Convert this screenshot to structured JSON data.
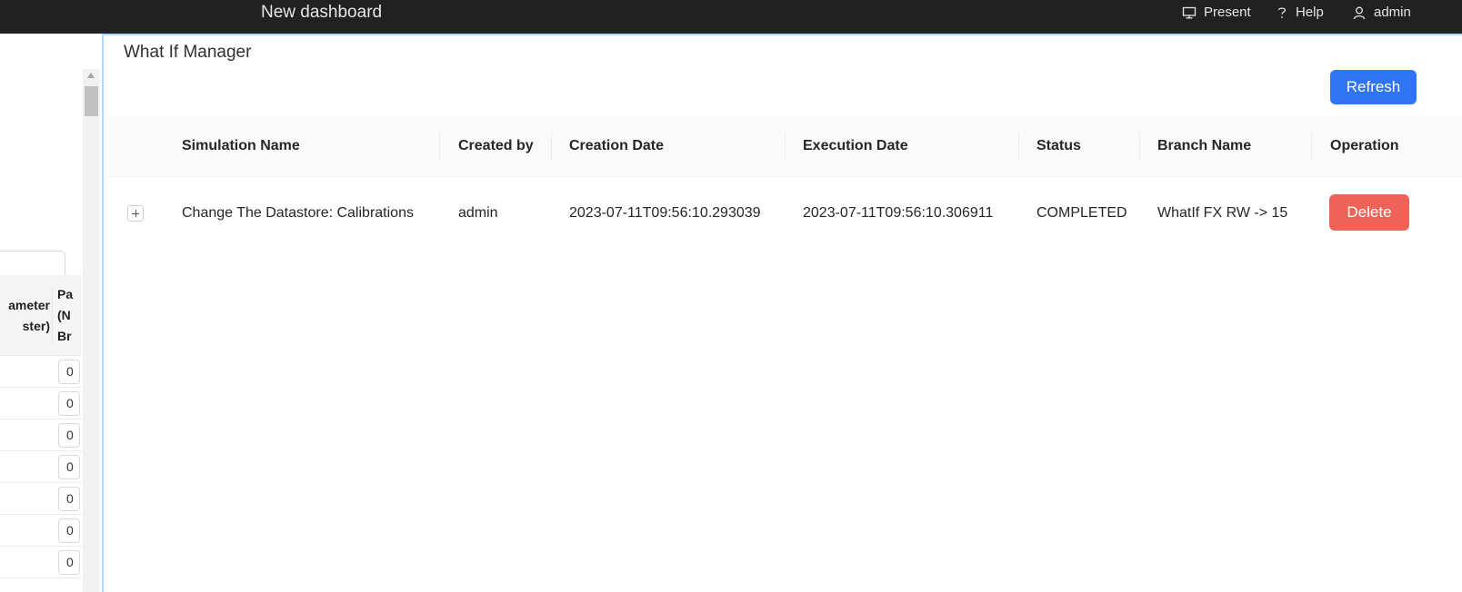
{
  "topbar": {
    "dashboard_title": "New dashboard",
    "present_label": "Present",
    "help_label": "Help",
    "user_label": "admin"
  },
  "left_panel": {
    "header_col1": "ameter\nster)",
    "header_col2": "Pa\n(N\nBr",
    "row_values": [
      "0",
      "0",
      "0",
      "0",
      "0",
      "0",
      "0"
    ]
  },
  "main": {
    "title": "What If Manager",
    "refresh_label": "Refresh",
    "columns": [
      "Simulation Name",
      "Created by",
      "Creation Date",
      "Execution Date",
      "Status",
      "Branch Name",
      "Operation"
    ],
    "rows": [
      {
        "simulation_name": "Change The Datastore: Calibrations",
        "created_by": "admin",
        "creation_date": "2023-07-11T09:56:10.293039",
        "execution_date": "2023-07-11T09:56:10.306911",
        "status": "COMPLETED",
        "branch_name": "WhatIf FX RW -> 15",
        "operation_label": "Delete"
      }
    ]
  },
  "colors": {
    "topbar_bg": "#212121",
    "primary": "#2f74f3",
    "danger": "#ef6258",
    "panel_border": "#b7d6fb"
  }
}
